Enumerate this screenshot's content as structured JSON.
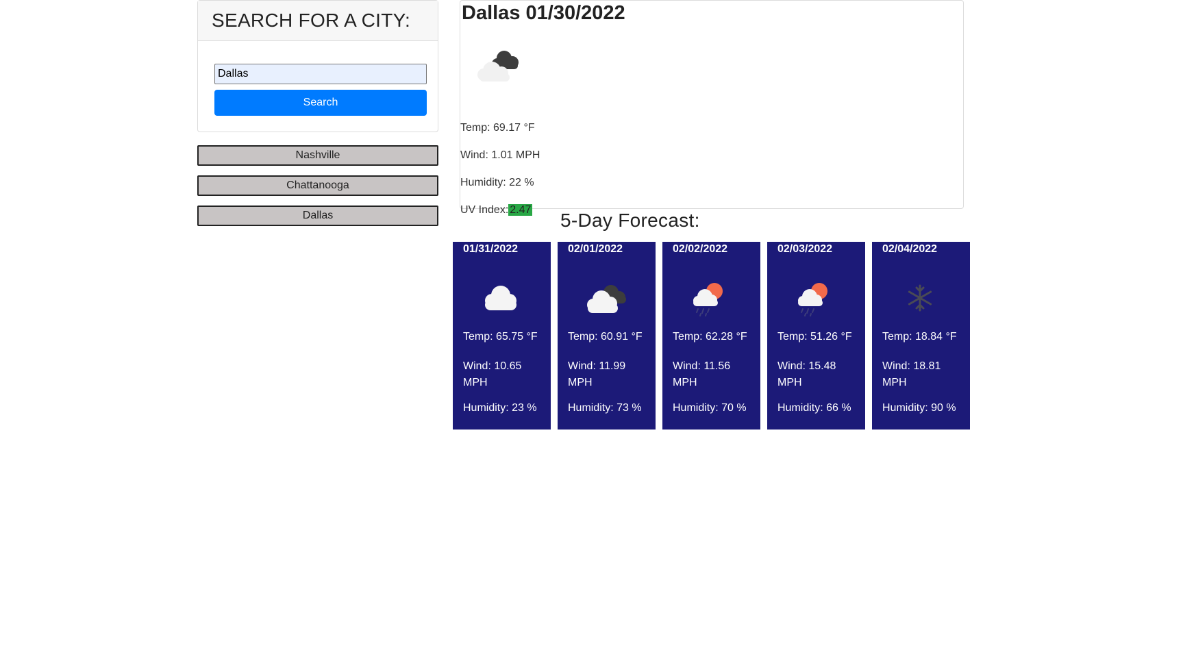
{
  "search": {
    "heading": "SEARCH FOR A CITY:",
    "input_value": "Dallas",
    "button_label": "Search"
  },
  "history": [
    "Nashville",
    "Chattanooga",
    "Dallas"
  ],
  "current": {
    "title": "Dallas 01/30/2022",
    "icon": "dark-cloud-icon",
    "temp": "Temp: 69.17 °F",
    "wind": "Wind: 1.01 MPH",
    "humidity": "Humidity: 22 %",
    "uv_label": "UV Index:",
    "uv_value": "2.47",
    "uv_color": "#28a745"
  },
  "forecast": {
    "heading": "5-Day Forecast:",
    "card_color": "#1c1a78",
    "days": [
      {
        "date": "01/31/2022",
        "icon": "cloud-icon",
        "temp": "Temp: 65.75 °F",
        "wind": "Wind: 10.65 MPH",
        "humidity": "Humidity: 23 %"
      },
      {
        "date": "02/01/2022",
        "icon": "broken-clouds-icon",
        "temp": "Temp: 60.91 °F",
        "wind": "Wind: 11.99 MPH",
        "humidity": "Humidity: 73 %"
      },
      {
        "date": "02/02/2022",
        "icon": "sun-rain-icon",
        "temp": "Temp: 62.28 °F",
        "wind": "Wind: 11.56 MPH",
        "humidity": "Humidity: 70 %"
      },
      {
        "date": "02/03/2022",
        "icon": "sun-rain-icon",
        "temp": "Temp: 51.26 °F",
        "wind": "Wind: 15.48 MPH",
        "humidity": "Humidity: 66 %"
      },
      {
        "date": "02/04/2022",
        "icon": "snowflake-icon",
        "temp": "Temp: 18.84 °F",
        "wind": "Wind: 18.81 MPH",
        "humidity": "Humidity: 90 %"
      }
    ]
  }
}
